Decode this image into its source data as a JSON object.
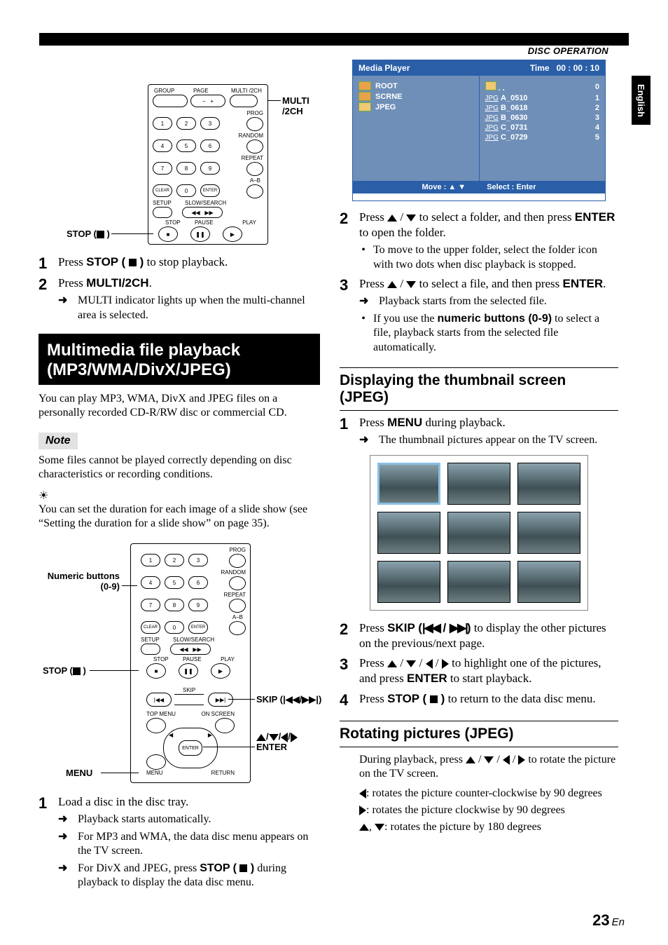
{
  "header": {
    "section": "DISC OPERATION",
    "lang_tab": "English"
  },
  "remote1": {
    "callout_multi": "MULTI /2CH",
    "callout_stop": "STOP (",
    "labels": {
      "group": "GROUP",
      "page": "PAGE",
      "multi": "MULTI /2CH",
      "prog": "PROG",
      "random": "RANDOM",
      "repeat": "REPEAT",
      "ab": "A–B",
      "clear": "CLEAR",
      "enter": "ENTER",
      "setup": "SETUP",
      "slow": "SLOW/SEARCH",
      "stop": "STOP",
      "pause": "PAUSE",
      "play": "PLAY"
    }
  },
  "leftA": {
    "s1": {
      "pre": "Press ",
      "btn": "STOP ( ",
      "post": " )",
      "tail": " to stop playback."
    },
    "s2": {
      "pre": "Press ",
      "btn": "MULTI/2CH",
      "post": ".",
      "sub1": "MULTI indicator lights up when the multi-channel area is selected."
    }
  },
  "section_title_1": "Multimedia file playback",
  "section_title_2": "(MP3/WMA/DivX/JPEG)",
  "intro": "You can play MP3, WMA, DivX and JPEG files on a personally recorded CD-R/RW disc or commercial CD.",
  "note_label": "Note",
  "note_body": "Some files cannot be played correctly depending on disc characteristics or recording conditions.",
  "tip": "You can set the duration for each image of a slide show (see “Setting the duration for a slide show” on page 35).",
  "remote2": {
    "callout_numeric": "Numeric buttons (0-9)",
    "callout_stop": "STOP (",
    "callout_skip": "SKIP (",
    "callout_enter": "ENTER",
    "callout_arrows": "/ / /",
    "callout_menu": "MENU",
    "labels": {
      "prog": "PROG",
      "random": "RANDOM",
      "repeat": "REPEAT",
      "ab": "A–B",
      "clear": "CLEAR",
      "enter": "ENTER",
      "setup": "SETUP",
      "slow": "SLOW/SEARCH",
      "stop": "STOP",
      "pause": "PAUSE",
      "play": "PLAY",
      "skip": "SKIP",
      "topmenu": "TOP MENU",
      "onscreen": "ON SCREEN",
      "menu": "MENU",
      "return": "RETURN"
    }
  },
  "leftB": {
    "s1": {
      "txt": "Load a disc in the disc tray.",
      "a": "Playback starts automatically.",
      "b": "For MP3 and WMA, the data disc menu appears on the TV screen.",
      "c_pre": "For DivX and JPEG, press ",
      "c_btn": "STOP ( ",
      "c_post": " )",
      "c_tail": " during playback to display the data disc menu."
    }
  },
  "mplayer": {
    "title": "Media Player",
    "time_label": "Time",
    "time": "00 : 00 : 10",
    "left": [
      {
        "icon": "folder",
        "label": "ROOT"
      },
      {
        "icon": "folder",
        "label": "SCRNE"
      },
      {
        "icon": "open",
        "label": "JPEG"
      }
    ],
    "right": [
      {
        "tag": "",
        "label": ". .",
        "n": "0"
      },
      {
        "tag": "JPG",
        "label": "A_0510",
        "n": "1"
      },
      {
        "tag": "JPG",
        "label": "B_0618",
        "n": "2"
      },
      {
        "tag": "JPG",
        "label": "B_0630",
        "n": "3"
      },
      {
        "tag": "JPG",
        "label": "C_0731",
        "n": "4"
      },
      {
        "tag": "JPG",
        "label": "C_0729",
        "n": "5"
      }
    ],
    "foot_move": "Move :",
    "foot_select": "Select : Enter"
  },
  "rightA": {
    "s2": {
      "pre": "Press ",
      "mid": " / ",
      "post": " to select a folder, and then press ",
      "btn": "ENTER",
      "tail": " to open the folder.",
      "tip": "To move to the upper folder, select the folder icon with two dots when disc playback is stopped."
    },
    "s3": {
      "pre": "Press ",
      "mid": " / ",
      "post": " to select a file, and then press ",
      "btn": "ENTER",
      "tail": ".",
      "a": "Playback starts from the selected file.",
      "b_pre": "If you use the ",
      "b_btn": "numeric buttons (0-9)",
      "b_post": " to select a file, playback starts from the selected file automatically."
    }
  },
  "sub_thumb": "Displaying the thumbnail screen (JPEG)",
  "thumb": {
    "s1": {
      "pre": "Press ",
      "btn": "MENU",
      "post": " during playback.",
      "a": "The thumbnail pictures appear on the TV screen."
    },
    "s2": {
      "pre": "Press ",
      "btn": "SKIP (",
      "mid": " / ",
      "post": ")",
      "tail": " to display the other pictures on the previous/next page."
    },
    "s3": {
      "pre": "Press ",
      "mid1": " / ",
      "mid2": " / ",
      "mid3": " / ",
      "post": " to highlight one of the pictures, and press ",
      "btn": "ENTER",
      "tail": " to start playback."
    },
    "s4": {
      "pre": "Press ",
      "btn": "STOP ( ",
      "post": " )",
      "tail": " to return to the data disc menu."
    }
  },
  "sub_rotate": "Rotating pictures (JPEG)",
  "rotate": {
    "p1_pre": "During playback, press ",
    "p1_mid1": " / ",
    "p1_mid2": " / ",
    "p1_mid3": " / ",
    "p1_post": " to rotate the picture on the TV screen.",
    "l": ": rotates the picture counter-clockwise by 90 degrees",
    "r": ": rotates the picture clockwise by 90 degrees",
    "ud": ": rotates the picture by 180 degrees"
  },
  "pagenum": "23",
  "pagelang": "En"
}
